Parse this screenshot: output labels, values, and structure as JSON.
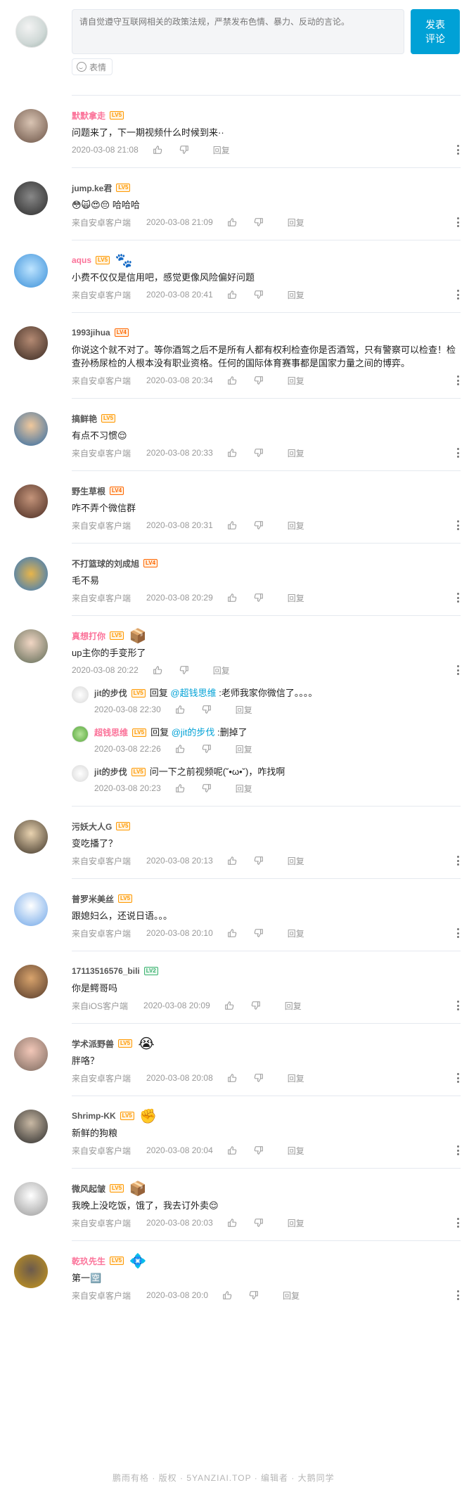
{
  "composer": {
    "placeholder": "请自觉遵守互联网相关的政策法规，严禁发布色情、暴力、反动的言论。",
    "submit_label": "发表\n评论",
    "emoji_label": "表情"
  },
  "labels": {
    "reply": "回复",
    "reply_prefix": "回复"
  },
  "comments": [
    {
      "user": "默默拿走",
      "vip": true,
      "level": "LV5",
      "text": "问题来了，下一期视频什么时候到来··",
      "source": "",
      "time": "2020-03-08 21:08"
    },
    {
      "user": "jump.ke君",
      "vip": false,
      "level": "LV5",
      "emoji": "😳🙀😍😔",
      "text": "哈哈哈",
      "source": "来自安卓客户端",
      "time": "2020-03-08 21:09"
    },
    {
      "user": "aqus",
      "vip": true,
      "level": "LV5",
      "pendant": "🐾",
      "text": "小费不仅仅是信用吧，感觉更像风险偏好问题",
      "source": "来自安卓客户端",
      "time": "2020-03-08 20:41"
    },
    {
      "user": "1993jihua",
      "vip": false,
      "level": "LV4",
      "text": "你说这个就不对了。等你酒驾之后不是所有人都有权利检查你是否酒驾，只有警察可以检查！检查孙杨尿检的人根本没有职业资格。任何的国际体育赛事都是国家力量之间的博弈。",
      "source": "来自安卓客户端",
      "time": "2020-03-08 20:34"
    },
    {
      "user": "搞鲜艳",
      "vip": false,
      "level": "LV5",
      "text": "有点不习惯😌",
      "source": "来自安卓客户端",
      "time": "2020-03-08 20:33"
    },
    {
      "user": "野生草根",
      "vip": false,
      "level": "LV4",
      "text": "咋不弄个微信群",
      "source": "来自安卓客户端",
      "time": "2020-03-08 20:31"
    },
    {
      "user": "不打篮球的刘成旭",
      "vip": false,
      "level": "LV4",
      "text": "毛不易",
      "source": "来自安卓客户端",
      "time": "2020-03-08 20:29"
    },
    {
      "user": "真想打你",
      "vip": true,
      "level": "LV5",
      "pendant": "📦",
      "text": "up主你的手变形了",
      "source": "",
      "time": "2020-03-08 20:22",
      "replies": [
        {
          "user": "jit的步伐",
          "vip": false,
          "level": "LV5",
          "at": "@超钱思维",
          "body": ":老师我家你微信了。。。。",
          "time": "2020-03-08 22:30"
        },
        {
          "user": "超钱思维",
          "vip": true,
          "level": "LV5",
          "at": "@jit的步伐",
          "body": ":删掉了",
          "time": "2020-03-08 22:26"
        },
        {
          "user": "jit的步伐",
          "vip": false,
          "level": "LV5",
          "at": "",
          "body": "问一下之前视频呢(˘•ω•˘)，咋找啊",
          "time": "2020-03-08 20:23"
        }
      ]
    },
    {
      "user": "污妖大人G",
      "vip": false,
      "level": "LV5",
      "text": "变吃播了？",
      "source": "来自安卓客户端",
      "time": "2020-03-08 20:13"
    },
    {
      "user": "普罗米美丝",
      "vip": false,
      "level": "LV5",
      "text": "跟媳妇么，还说日语。。。",
      "source": "来自安卓客户端",
      "time": "2020-03-08 20:10"
    },
    {
      "user": "17113516576_bili",
      "vip": false,
      "level": "LV2",
      "text": "你是鳄哥吗",
      "source": "来自iOS客户端",
      "time": "2020-03-08 20:09"
    },
    {
      "user": "学术派野兽",
      "vip": false,
      "level": "LV5",
      "pendant": "😭",
      "text": "胖咯？",
      "source": "来自安卓客户端",
      "time": "2020-03-08 20:08"
    },
    {
      "user": "Shrimp-KK",
      "vip": false,
      "level": "LV5",
      "pendant": "✊",
      "text": "新鲜的狗粮",
      "source": "来自安卓客户端",
      "time": "2020-03-08 20:04"
    },
    {
      "user": "微风起皱",
      "vip": false,
      "level": "LV5",
      "pendant": "📦",
      "text": "我晚上没吃饭，饿了，我去订外卖😌",
      "source": "来自安卓客户端",
      "time": "2020-03-08 20:03"
    },
    {
      "user": "乾玖先生",
      "vip": true,
      "level": "LV5",
      "pendant": "💠",
      "text": "第一🈳",
      "source": "来自安卓客户端",
      "time": "2020-03-08 20:0"
    }
  ],
  "watermark": "鹏雨有格 · 版权 · 5YANZIAI.TOP · 编辑者 · 大鹅同学",
  "colors": {
    "accent": "#00a1d6",
    "vip_name": "#fb7299",
    "divider": "#e5e9ef"
  }
}
